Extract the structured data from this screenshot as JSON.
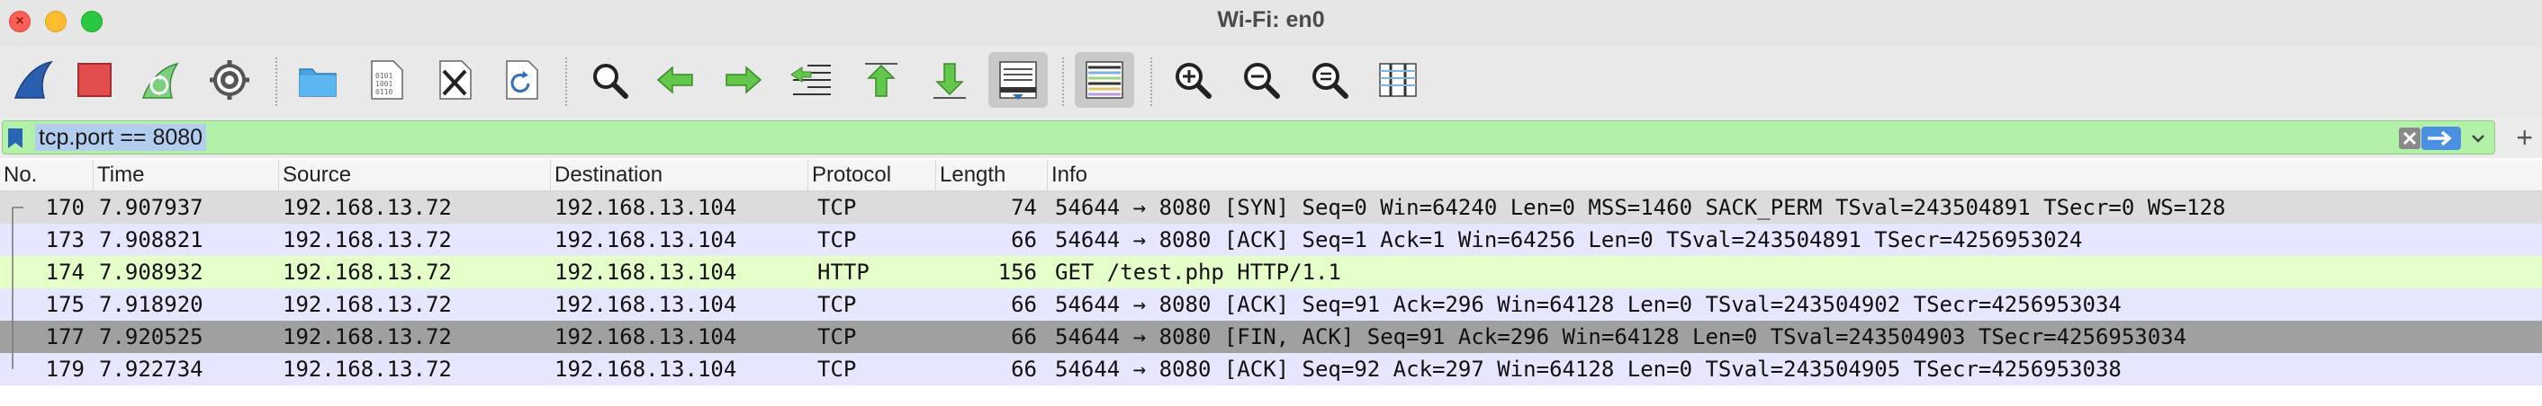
{
  "window": {
    "title": "Wi-Fi: en0",
    "traffic_lights": [
      "close",
      "minimize",
      "zoom"
    ]
  },
  "toolbar": {
    "buttons": [
      {
        "name": "start-capture-button",
        "icon": "shark-fin-icon"
      },
      {
        "name": "stop-capture-button",
        "icon": "stop-square-icon"
      },
      {
        "name": "restart-capture-button",
        "icon": "restart-fin-icon"
      },
      {
        "name": "capture-options-button",
        "icon": "gear-icon"
      },
      {
        "name": "open-file-button",
        "icon": "folder-icon"
      },
      {
        "name": "save-file-button",
        "icon": "binary-file-icon"
      },
      {
        "name": "close-file-button",
        "icon": "close-file-icon"
      },
      {
        "name": "reload-file-button",
        "icon": "reload-file-icon"
      },
      {
        "name": "find-packet-button",
        "icon": "magnifier-icon"
      },
      {
        "name": "go-back-button",
        "icon": "arrow-left-icon"
      },
      {
        "name": "go-forward-button",
        "icon": "arrow-right-icon"
      },
      {
        "name": "go-to-packet-button",
        "icon": "goto-packet-icon"
      },
      {
        "name": "go-first-packet-button",
        "icon": "arrow-up-bar-icon"
      },
      {
        "name": "go-last-packet-button",
        "icon": "arrow-down-bar-icon"
      },
      {
        "name": "auto-scroll-button",
        "icon": "autoscroll-icon"
      },
      {
        "name": "colorize-button",
        "icon": "colorize-lines-icon"
      },
      {
        "name": "zoom-in-button",
        "icon": "zoom-in-icon"
      },
      {
        "name": "zoom-out-button",
        "icon": "zoom-out-icon"
      },
      {
        "name": "normal-size-button",
        "icon": "zoom-reset-icon"
      },
      {
        "name": "resize-columns-button",
        "icon": "resize-columns-icon"
      }
    ]
  },
  "filter": {
    "value": "tcp.port == 8080",
    "plus": "+"
  },
  "columns": [
    "No.",
    "Time",
    "Source",
    "Destination",
    "Protocol",
    "Length",
    "Info"
  ],
  "colors": {
    "row_tcp": "#e7e6ff",
    "row_http": "#e4ffc7",
    "row_first": "#dcdcdc",
    "row_selected": "#a0a0a0",
    "filter_bg": "#b4f1a8"
  },
  "packets": [
    {
      "no": "170",
      "time": "7.907937",
      "source": "192.168.13.72",
      "destination": "192.168.13.104",
      "protocol": "TCP",
      "length": "74",
      "info": "54644 → 8080 [SYN] Seq=0 Win=64240 Len=0 MSS=1460 SACK_PERM TSval=243504891 TSecr=0 WS=128",
      "style": "first"
    },
    {
      "no": "173",
      "time": "7.908821",
      "source": "192.168.13.72",
      "destination": "192.168.13.104",
      "protocol": "TCP",
      "length": "66",
      "info": "54644 → 8080 [ACK] Seq=1 Ack=1 Win=64256 Len=0 TSval=243504891 TSecr=4256953024",
      "style": "tcp"
    },
    {
      "no": "174",
      "time": "7.908932",
      "source": "192.168.13.72",
      "destination": "192.168.13.104",
      "protocol": "HTTP",
      "length": "156",
      "info": "GET /test.php HTTP/1.1",
      "style": "http"
    },
    {
      "no": "175",
      "time": "7.918920",
      "source": "192.168.13.72",
      "destination": "192.168.13.104",
      "protocol": "TCP",
      "length": "66",
      "info": "54644 → 8080 [ACK] Seq=91 Ack=296 Win=64128 Len=0 TSval=243504902 TSecr=4256953034",
      "style": "tcp"
    },
    {
      "no": "177",
      "time": "7.920525",
      "source": "192.168.13.72",
      "destination": "192.168.13.104",
      "protocol": "TCP",
      "length": "66",
      "info": "54644 → 8080 [FIN, ACK] Seq=91 Ack=296 Win=64128 Len=0 TSval=243504903 TSecr=4256953034",
      "style": "selected"
    },
    {
      "no": "179",
      "time": "7.922734",
      "source": "192.168.13.72",
      "destination": "192.168.13.104",
      "protocol": "TCP",
      "length": "66",
      "info": "54644 → 8080 [ACK] Seq=92 Ack=297 Win=64128 Len=0 TSval=243504905 TSecr=4256953038",
      "style": "tcp"
    }
  ]
}
